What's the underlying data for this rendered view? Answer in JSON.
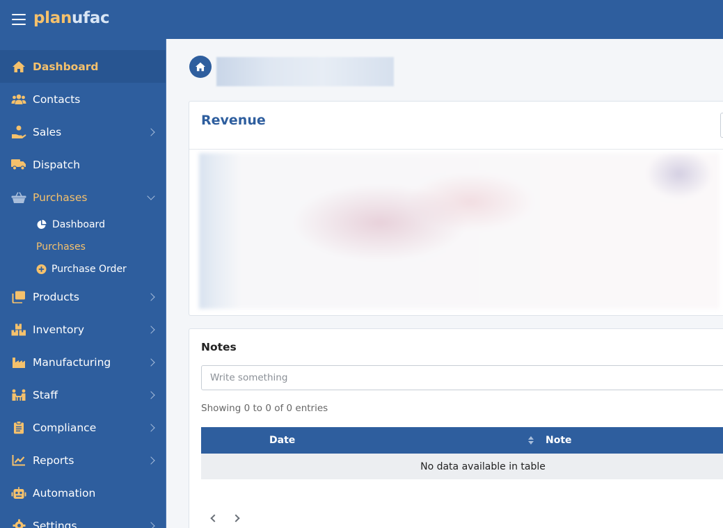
{
  "app": {
    "logo_part1": "plan",
    "logo_part2": "ufac"
  },
  "sidebar": {
    "items": [
      {
        "label": "Dashboard",
        "icon": "home-icon"
      },
      {
        "label": "Contacts",
        "icon": "users-icon"
      },
      {
        "label": "Sales",
        "icon": "sales-hand-icon"
      },
      {
        "label": "Dispatch",
        "icon": "truck-icon"
      },
      {
        "label": "Purchases",
        "icon": "basket-icon"
      },
      {
        "label": "Products",
        "icon": "products-icon"
      },
      {
        "label": "Inventory",
        "icon": "boxes-icon"
      },
      {
        "label": "Manufacturing",
        "icon": "factory-icon"
      },
      {
        "label": "Staff",
        "icon": "staff-icon"
      },
      {
        "label": "Compliance",
        "icon": "clipboard-icon"
      },
      {
        "label": "Reports",
        "icon": "chart-line-icon"
      },
      {
        "label": "Automation",
        "icon": "robot-icon"
      },
      {
        "label": "Settings",
        "icon": "gear-icon"
      }
    ],
    "purchases_sub": [
      {
        "label": "Dashboard",
        "icon": "pie-chart-icon"
      },
      {
        "label": "Purchases"
      },
      {
        "label": "Purchase Order",
        "icon": "plus-circle-icon"
      }
    ]
  },
  "main": {
    "revenue_title": "Revenue",
    "notes": {
      "title": "Notes",
      "placeholder": "Write something",
      "entries_info": "Showing 0 to 0 of 0 entries",
      "columns": [
        "Date",
        "Note"
      ],
      "empty_text": "No data available in table"
    }
  },
  "colors": {
    "primary": "#2e5e9e",
    "accent": "#f5c16c"
  }
}
